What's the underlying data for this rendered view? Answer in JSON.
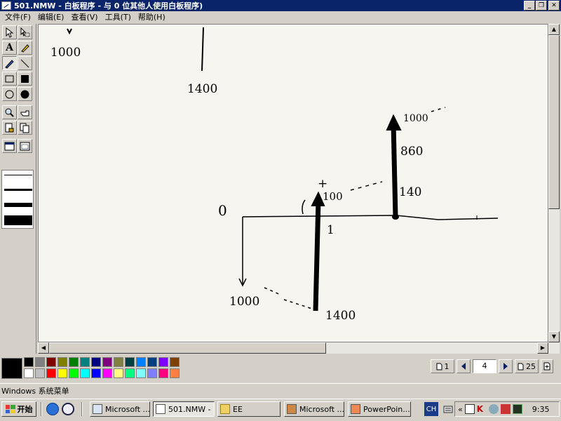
{
  "window": {
    "title": "501.NMW - 白板程序 - 与 0 位其他人使用白板程序)",
    "minimize_label": "_",
    "restore_label": "❐",
    "close_label": "✕"
  },
  "menu": {
    "items": [
      {
        "label": "文件(F)"
      },
      {
        "label": "编辑(E)"
      },
      {
        "label": "查看(V)"
      },
      {
        "label": "工具(T)"
      },
      {
        "label": "帮助(H)"
      }
    ]
  },
  "toolbox": {
    "text_tool_label": "A"
  },
  "canvas": {
    "annotations": [
      "1000",
      "1400",
      "0",
      "+",
      "100",
      "1",
      "1000",
      "1400",
      "1000",
      "860",
      "140"
    ]
  },
  "palette": {
    "current_color": "#000000",
    "colors": [
      "#000000",
      "#808080",
      "#800000",
      "#808000",
      "#008000",
      "#008080",
      "#000080",
      "#800080",
      "#808040",
      "#004040",
      "#0080ff",
      "#004080",
      "#8000ff",
      "#804000",
      "#ffffff",
      "#c0c0c0",
      "#ff0000",
      "#ffff00",
      "#00ff00",
      "#00ffff",
      "#0000ff",
      "#ff00ff",
      "#ffff80",
      "#00ff80",
      "#80ffff",
      "#8080ff",
      "#ff0080",
      "#ff8040"
    ]
  },
  "page_nav": {
    "first_label": "1",
    "current_page": "4",
    "last_label": "25"
  },
  "statusbar": {
    "text": "Windows 系统菜单"
  },
  "taskbar": {
    "start_label": "开始",
    "tasks": [
      {
        "label": "Microsoft ...",
        "active": false
      },
      {
        "label": "501.NMW - ...",
        "active": true
      },
      {
        "label": "EE",
        "active": false
      },
      {
        "label": "Microsoft ...",
        "active": false
      },
      {
        "label": "PowerPoin...",
        "active": false
      }
    ],
    "lang": "CH",
    "time": "9:35"
  }
}
